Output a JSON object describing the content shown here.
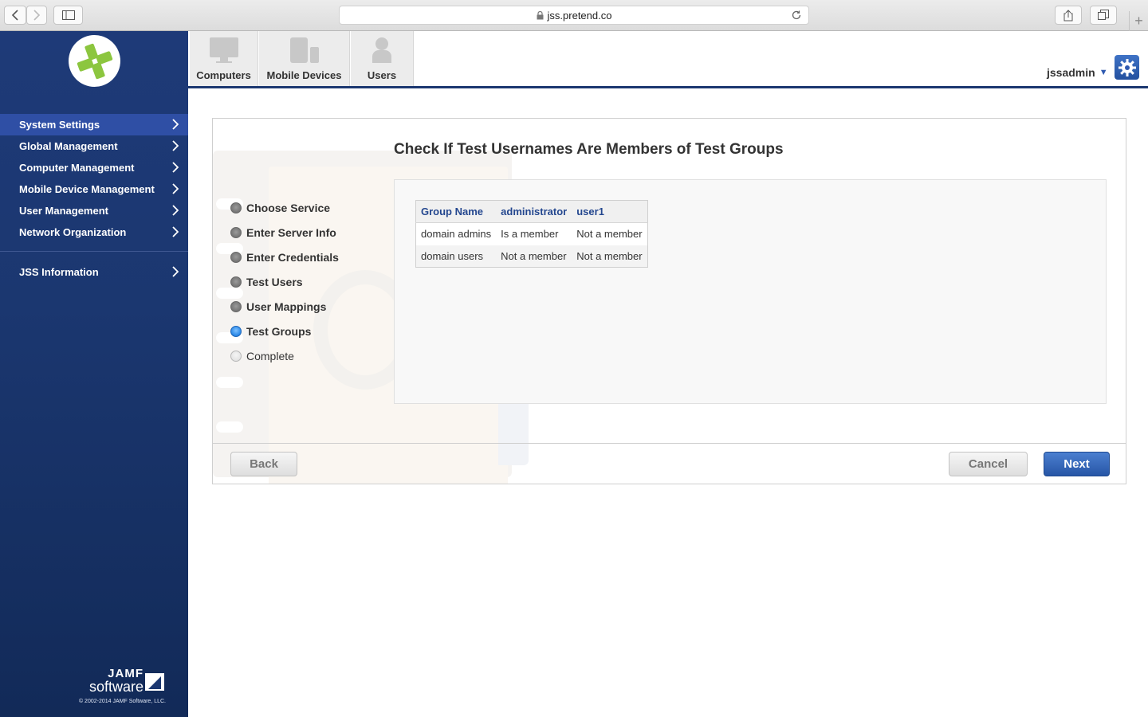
{
  "browser": {
    "url": "jss.pretend.co"
  },
  "sidebar": {
    "items": [
      {
        "label": "System Settings"
      },
      {
        "label": "Global Management"
      },
      {
        "label": "Computer Management"
      },
      {
        "label": "Mobile Device Management"
      },
      {
        "label": "User Management"
      },
      {
        "label": "Network Organization"
      }
    ],
    "info_item": {
      "label": "JSS Information"
    },
    "brand": {
      "line1": "JAMF",
      "line2": "software",
      "copyright": "© 2002-2014 JAMF Software, LLC."
    }
  },
  "topnav": {
    "tabs": [
      {
        "label": "Computers"
      },
      {
        "label": "Mobile Devices"
      },
      {
        "label": "Users"
      }
    ],
    "username": "jssadmin"
  },
  "wizard": {
    "title": "Check If Test Usernames Are Members of Test Groups",
    "steps": [
      {
        "label": "Choose Service"
      },
      {
        "label": "Enter Server Info"
      },
      {
        "label": "Enter Credentials"
      },
      {
        "label": "Test Users"
      },
      {
        "label": "User Mappings"
      },
      {
        "label": "Test Groups"
      },
      {
        "label": "Complete"
      }
    ],
    "current_step": "Test Groups",
    "table": {
      "headers": [
        "Group Name",
        "administrator",
        "user1"
      ],
      "rows": [
        [
          "domain admins",
          "Is a member",
          "Not a member"
        ],
        [
          "domain users",
          "Not a member",
          "Not a member"
        ]
      ]
    },
    "buttons": {
      "back": "Back",
      "cancel": "Cancel",
      "next": "Next"
    }
  },
  "colors": {
    "sidebar_bg": "#1b3770",
    "sidebar_active": "#2f4fa5",
    "accent": "#2756a6",
    "table_header_text": "#24478f",
    "logo_green": "#8cc63f"
  }
}
